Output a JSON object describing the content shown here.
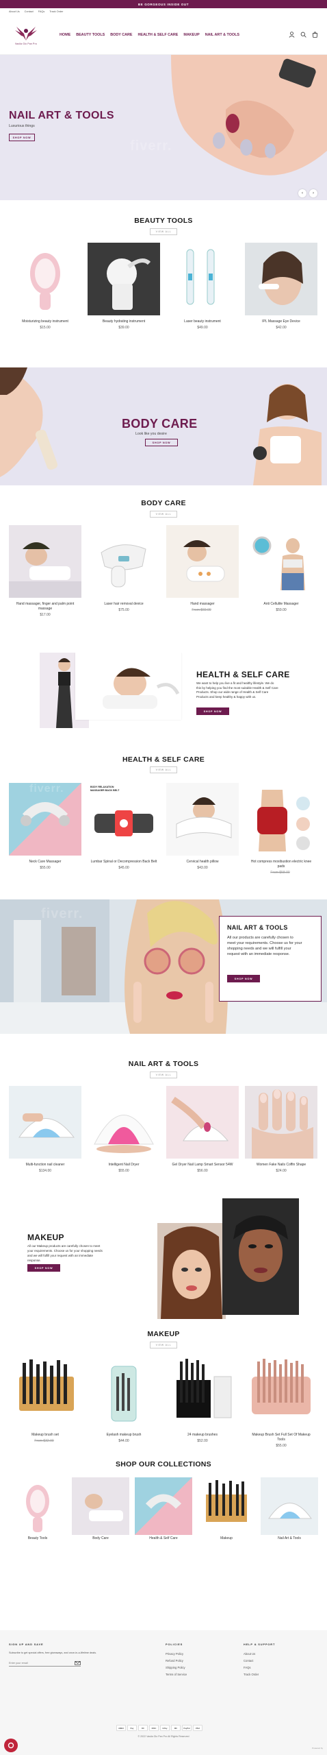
{
  "announcement": "BE GORGEOUS INSIDE OUT",
  "util_links": [
    "About Us",
    "Contact",
    "FAQs",
    "Track Order"
  ],
  "logo_text": "Vasila Glo Pan Pro",
  "nav": [
    "HOME",
    "BEAUTY TOOLS",
    "BODY CARE",
    "HEALTH & SELF CARE",
    "MAKEUP",
    "NAIL ART & TOOLS"
  ],
  "hero": {
    "title": "NAIL ART & TOOLS",
    "subtitle": "Luxurious things",
    "button": "SHOP NOW"
  },
  "watermark": "fiverr.",
  "beauty": {
    "title": "BEAUTY TOOLS",
    "view_all": "VIEW ALL",
    "products": [
      {
        "name": "Moisturizing beauty instrument",
        "price": "$15.00"
      },
      {
        "name": "Beauty hydrating instrument",
        "price": "$39.00"
      },
      {
        "name": "Laser beauty instrument",
        "price": "$49.00"
      },
      {
        "name": "IPL Massage Eye Device",
        "price": "$42.00"
      }
    ]
  },
  "body_banner": {
    "title": "BODY CARE",
    "subtitle": "Look like you desire",
    "button": "SHOP NOW"
  },
  "body": {
    "title": "BODY CARE",
    "view_all": "VIEW ALL",
    "products": [
      {
        "name": "Hand massager, finger and palm point massage",
        "price": "$17.00"
      },
      {
        "name": "Laser hair removal device",
        "price": "$75.00"
      },
      {
        "name": "Hand massager",
        "old": "From $69.00",
        "price": ""
      },
      {
        "name": "Anti Cellulite Massager",
        "price": "$59.00"
      }
    ]
  },
  "health_banner": {
    "title": "HEALTH & SELF CARE",
    "text": "We want to help you live a fit and healthy lifestyle. We do this by helping you find the most suitable Health & Self Care Products. Shop our wide range of Health & Self Care Products and keep healthy & happy with us.",
    "button": "SHOP NOW"
  },
  "health": {
    "title": "HEALTH & SELF CARE",
    "view_all": "VIEW ALL",
    "products": [
      {
        "name": "Neck Care Massager",
        "price": "$55.00"
      },
      {
        "name": "Lumbar Spinal or Decompression Back Belt",
        "price": "$45.00"
      },
      {
        "name": "Cervical health pillow",
        "price": "$43.00"
      },
      {
        "name": "Hot compress moxibustion electric knee pads",
        "old": "From $58.00",
        "price": ""
      }
    ],
    "badge": "BODY RELAXATION MASSAGER BACK BELT"
  },
  "nail_banner": {
    "title": "NAIL ART & TOOLS",
    "text": "All our products are carefully chosen to meet your requirements. Choose us for your shopping needs and we will fulfill your request with an immediate response.",
    "button": "SHOP NOW"
  },
  "nail": {
    "title": "NAIL ART & TOOLS",
    "view_all": "VIEW ALL",
    "products": [
      {
        "name": "Multi-function nail cleaner",
        "price": "$134.00"
      },
      {
        "name": "Intelligent Nail Dryer",
        "price": "$55.00"
      },
      {
        "name": "Gel Dryer Nail Lamp Smart Sensor 54W",
        "price": "$56.00"
      },
      {
        "name": "Women Fake Nails Coffin Shape",
        "price": "$24.00"
      }
    ]
  },
  "makeup_banner": {
    "title": "MAKEUP",
    "text": "All our Makeup products are carefully chosen to meet your requirements. Choose us for your shopping needs and we will fulfill your request with an immediate response.",
    "button": "SHOP NOW"
  },
  "makeup": {
    "title": "MAKEUP",
    "view_all": "VIEW ALL",
    "products": [
      {
        "name": "Makeup brush set",
        "old": "From $32.00",
        "price": ""
      },
      {
        "name": "Eyelash makeup brush",
        "price": "$44.00"
      },
      {
        "name": "24 makeup brushes",
        "price": "$52.00"
      },
      {
        "name": "Makeup Brush Set Full Set Of Makeup Tools",
        "price": "$55.00"
      }
    ]
  },
  "collections": {
    "title": "SHOP OUR COLLECTIONS",
    "items": [
      "Beauty Tools",
      "Body Care",
      "Health & Self Care",
      "Makeup",
      "Nail Art & Tools"
    ]
  },
  "footer": {
    "signup_title": "SIGN UP AND SAVE",
    "signup_text": "Subscribe to get special offers, free giveaways, and once-in-a-lifetime deals.",
    "email_placeholder": "Enter your email",
    "policies_title": "POLICIES",
    "policies": [
      "Privacy Policy",
      "Refund Policy",
      "Shipping Policy",
      "Terms of Service"
    ],
    "help_title": "HELP & SUPPORT",
    "help": [
      "About Us",
      "Contact",
      "FAQs",
      "Track Order"
    ],
    "copyright": "© 2022 Vasila Glo Pan Pro All Rights Reserved",
    "payments": [
      "AMEX",
      "Pay",
      "DC",
      "DISC",
      "GPay",
      "MC",
      "PayPal",
      "VISA"
    ],
    "chat_label": "Powered by"
  }
}
